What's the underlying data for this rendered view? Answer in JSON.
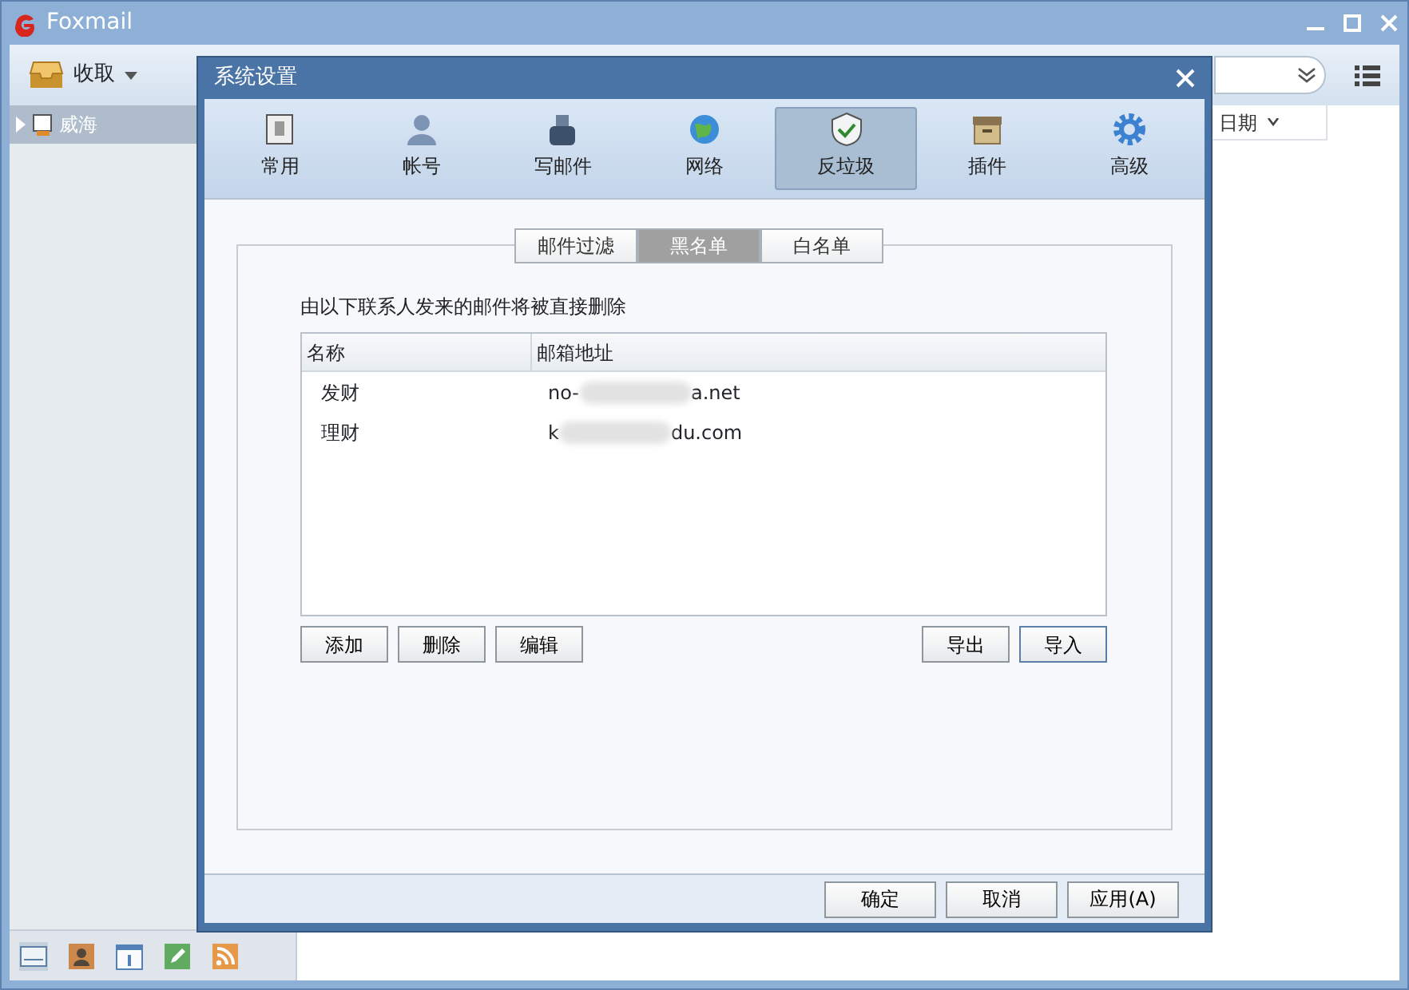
{
  "app": {
    "title": "Foxmail"
  },
  "toolbar": {
    "receive": "收取"
  },
  "folders": [
    {
      "label": "威海",
      "expanded": false
    }
  ],
  "list_header": {
    "date": "日期"
  },
  "nav_icons": [
    {
      "kind": "mail",
      "selected": true
    },
    {
      "kind": "contacts",
      "selected": false
    },
    {
      "kind": "calendar",
      "selected": false
    },
    {
      "kind": "notes",
      "selected": false
    },
    {
      "kind": "rss",
      "selected": false
    }
  ],
  "dialog": {
    "title": "系统设置",
    "categories": [
      {
        "label": "常用",
        "kind": "general",
        "selected": false
      },
      {
        "label": "帐号",
        "kind": "account",
        "selected": false
      },
      {
        "label": "写邮件",
        "kind": "compose",
        "selected": false
      },
      {
        "label": "网络",
        "kind": "network",
        "selected": false
      },
      {
        "label": "反垃圾",
        "kind": "antispam",
        "selected": true
      },
      {
        "label": "插件",
        "kind": "plugin",
        "selected": false
      },
      {
        "label": "高级",
        "kind": "advanced",
        "selected": false
      }
    ],
    "subtabs": [
      {
        "label": "邮件过滤",
        "selected": false
      },
      {
        "label": "黑名单",
        "selected": true
      },
      {
        "label": "白名单",
        "selected": false
      }
    ],
    "description": "由以下联系人发来的邮件将被直接删除",
    "table": {
      "columns": [
        "名称",
        "邮箱地址"
      ],
      "rows": [
        {
          "name": "发财",
          "address_start": "no-",
          "address_end": "a.net"
        },
        {
          "name": "理财",
          "address_start": "k",
          "address_end": "du.com"
        }
      ]
    },
    "left_buttons": [
      "添加",
      "删除",
      "编辑"
    ],
    "right_buttons": [
      "导出",
      "导入"
    ],
    "footer_buttons": [
      "确定",
      "取消",
      "应用(A)"
    ]
  }
}
